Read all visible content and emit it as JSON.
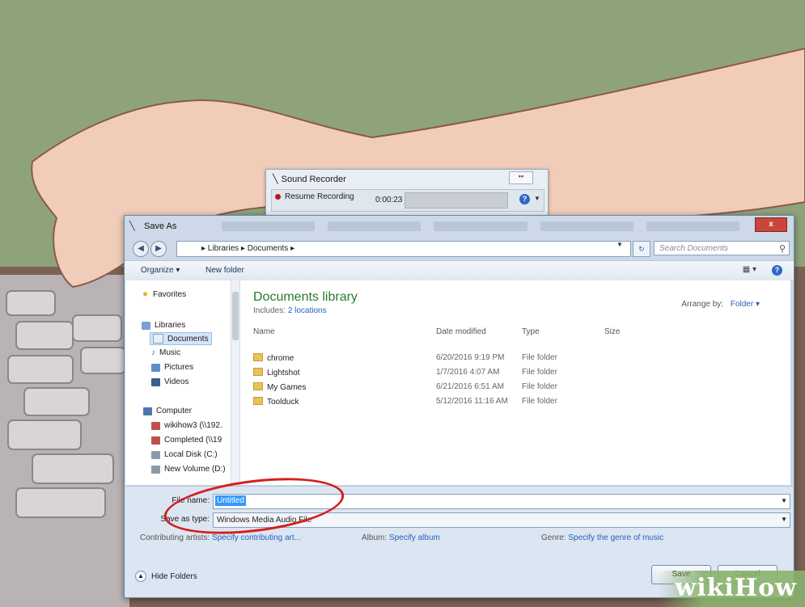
{
  "recorder": {
    "title": "Sound Recorder",
    "resume_label": "Resume Recording",
    "time": "0:00:23",
    "help_icon": "?"
  },
  "window": {
    "title": "Save As",
    "close_label": "x",
    "breadcrumb": "▸ Libraries ▸ Documents ▸",
    "search_placeholder": "Search Documents",
    "toolbar": {
      "organize": "Organize ▾",
      "new_folder": "New folder"
    }
  },
  "sidebar": {
    "favorites": "Favorites",
    "libraries": "Libraries",
    "documents": "Documents",
    "music": "Music",
    "pictures": "Pictures",
    "videos": "Videos",
    "computer": "Computer",
    "drive1": "wikihow3 (\\\\192.",
    "drive2": "Completed (\\\\19",
    "drive3": "Local Disk (C:)",
    "drive4": "New Volume (D:)"
  },
  "library": {
    "title": "Documents library",
    "includes_label": "Includes:",
    "includes_link": "2 locations",
    "arrange_label": "Arrange by:",
    "arrange_value": "Folder ▾",
    "columns": {
      "name": "Name",
      "date": "Date modified",
      "type": "Type",
      "size": "Size"
    },
    "rows": [
      {
        "name": "chrome",
        "date": "6/20/2016 9:19 PM",
        "type": "File folder"
      },
      {
        "name": "Lightshot",
        "date": "1/7/2016 4:07 AM",
        "type": "File folder"
      },
      {
        "name": "My Games",
        "date": "6/21/2016 6:51 AM",
        "type": "File folder"
      },
      {
        "name": "Toolduck",
        "date": "5/12/2016 11:16 AM",
        "type": "File folder"
      }
    ]
  },
  "form": {
    "file_name_label": "File name:",
    "file_name_value": "Untitled",
    "save_type_label": "Save as type:",
    "save_type_value": "Windows Media Audio File",
    "artists_label": "Contributing artists:",
    "artists_value": "Specify contributing art...",
    "album_label": "Album:",
    "album_value": "Specify album",
    "genre_label": "Genre:",
    "genre_value": "Specify the genre of music",
    "hide_folders": "Hide Folders",
    "save_button": "Save",
    "cancel_button": "Cancel"
  },
  "watermark": "wikiHow",
  "colors": {
    "annotation": "#d3201d",
    "library_title": "#2b7a2b",
    "link": "#2561b8"
  }
}
